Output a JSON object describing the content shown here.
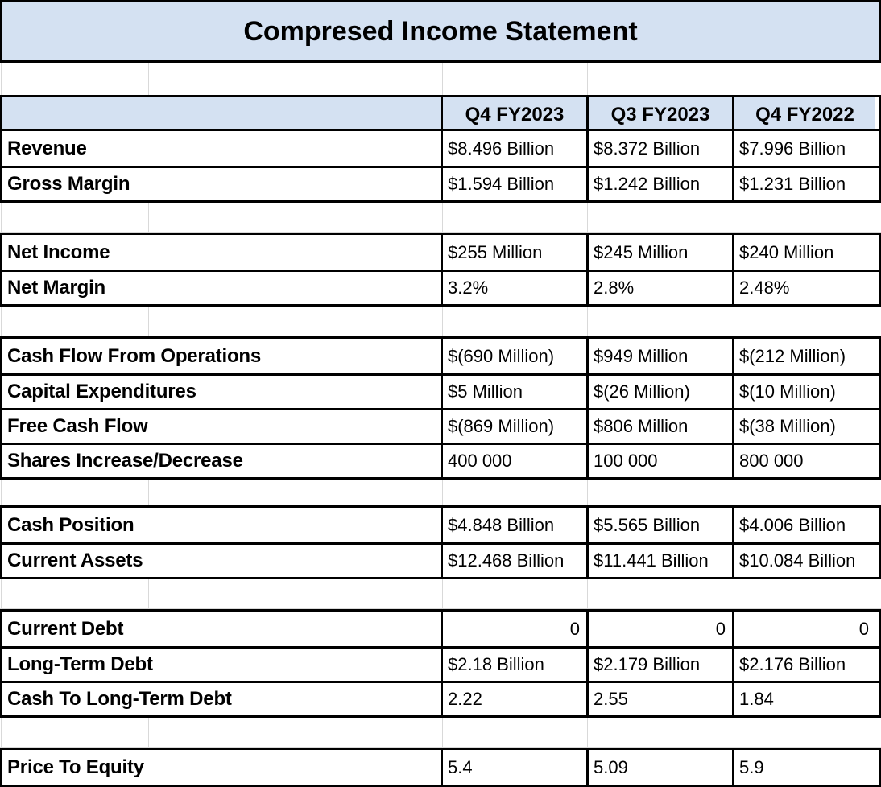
{
  "title": "Compresed Income Statement",
  "theme": {
    "header_fill": "#D4E1F2",
    "border": "#000000",
    "gridline": "#D9D9D9",
    "background": "#FFFFFF"
  },
  "columns": {
    "row_label_header": "",
    "periods": [
      "Q4 FY2023",
      "Q3 FY2023",
      "Q4 FY2022"
    ]
  },
  "sections": [
    {
      "name": "income",
      "rows": [
        {
          "label": "Revenue",
          "values": [
            "$8.496 Billion",
            "$8.372 Billion",
            "$7.996 Billion"
          ],
          "align": "left"
        },
        {
          "label": "Gross Margin",
          "values": [
            "$1.594 Billion",
            "$1.242 Billion",
            "$1.231 Billion"
          ],
          "align": "left"
        }
      ]
    },
    {
      "name": "profitability",
      "rows": [
        {
          "label": "Net Income",
          "values": [
            "$255 Million",
            "$245 Million",
            "$240 Million"
          ],
          "align": "left"
        },
        {
          "label": "Net Margin",
          "values": [
            "3.2%",
            "2.8%",
            "2.48%"
          ],
          "align": "left"
        }
      ]
    },
    {
      "name": "cash-flow",
      "rows": [
        {
          "label": "Cash Flow From Operations",
          "values": [
            "$(690 Million)",
            "$949 Million",
            "$(212 Million)"
          ],
          "align": "left"
        },
        {
          "label": "Capital Expenditures",
          "values": [
            "$5 Million",
            "$(26 Million)",
            "$(10 Million)"
          ],
          "align": "left"
        },
        {
          "label": "Free Cash Flow",
          "values": [
            "$(869 Million)",
            "$806 Million",
            "$(38 Million)"
          ],
          "align": "left"
        },
        {
          "label": "Shares Increase/Decrease",
          "values": [
            "400 000",
            "100 000",
            "800 000"
          ],
          "align": "left"
        }
      ]
    },
    {
      "name": "balance-sheet",
      "rows": [
        {
          "label": "Cash Position",
          "values": [
            "$4.848 Billion",
            "$5.565 Billion",
            "$4.006 Billion"
          ],
          "align": "left"
        },
        {
          "label": "Current Assets",
          "values": [
            "$12.468 Billion",
            "$11.441 Billion",
            "$10.084 Billion"
          ],
          "align": "left"
        }
      ]
    },
    {
      "name": "debt",
      "rows": [
        {
          "label": "Current Debt",
          "values": [
            "0",
            "0",
            "0"
          ],
          "align": "right"
        },
        {
          "label": "Long-Term Debt",
          "values": [
            "$2.18 Billion",
            "$2.179 Billion",
            "$2.176 Billion"
          ],
          "align": "left"
        },
        {
          "label": "Cash To Long-Term Debt",
          "values": [
            "2.22",
            "2.55",
            "1.84"
          ],
          "align": "left"
        }
      ]
    },
    {
      "name": "valuation",
      "rows": [
        {
          "label": "Price To Equity",
          "values": [
            "5.4",
            "5.09",
            "5.9"
          ],
          "align": "left"
        }
      ]
    }
  ]
}
